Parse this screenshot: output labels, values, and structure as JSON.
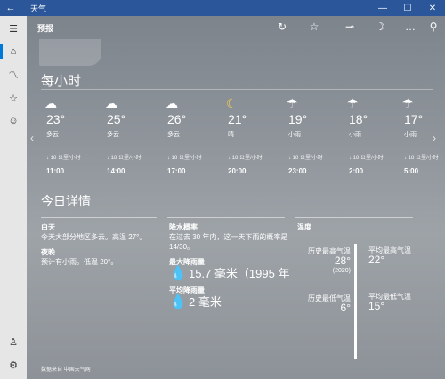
{
  "window": {
    "title": "天气",
    "back": "←",
    "minimize": "—",
    "maximize": "☐",
    "close": "✕"
  },
  "sidebar": {
    "menu": "☰",
    "items": [
      {
        "name": "home",
        "glyph": "⌂"
      },
      {
        "name": "chart",
        "glyph": "〽"
      },
      {
        "name": "favorites",
        "glyph": "☆"
      },
      {
        "name": "lifestyle",
        "glyph": "☺"
      }
    ],
    "bottom": [
      {
        "name": "account",
        "glyph": "♙"
      },
      {
        "name": "settings",
        "glyph": "⚙"
      }
    ]
  },
  "cmdbar": {
    "label": "预报",
    "refresh": "↻",
    "favorite": "☆",
    "pin": "⊸",
    "night": "☽",
    "more": "…",
    "search": "⚲"
  },
  "hourly": {
    "title": "每小时",
    "hours": [
      {
        "icon": "☁",
        "temp": "23°",
        "cond": "多云",
        "wind": "↓ 18 公里/小时",
        "time": "11:00"
      },
      {
        "icon": "☁",
        "temp": "25°",
        "cond": "多云",
        "wind": "↓ 18 公里/小时",
        "time": "14:00"
      },
      {
        "icon": "☁",
        "temp": "26°",
        "cond": "多云",
        "wind": "↓ 18 公里/小时",
        "time": "17:00"
      },
      {
        "icon": "☾",
        "temp": "21°",
        "cond": "晴",
        "wind": "↓ 18 公里/小时",
        "time": "20:00"
      },
      {
        "icon": "☂",
        "temp": "19°",
        "cond": "小雨",
        "wind": "↓ 18 公里/小时",
        "time": "23:00"
      },
      {
        "icon": "☂",
        "temp": "18°",
        "cond": "小雨",
        "wind": "↓ 18 公里/小时",
        "time": "2:00"
      },
      {
        "icon": "☂",
        "temp": "17°",
        "cond": "小雨",
        "wind": "↓ 18 公里/小时",
        "time": "5:00"
      }
    ],
    "prev": "‹",
    "next": "›"
  },
  "details": {
    "title": "今日详情",
    "day_label": "白天",
    "day_text": "今天大部分地区多云。高温 27°。",
    "night_label": "夜晚",
    "night_text": "预计有小雨。低温 20°。",
    "precip_label": "降水概率",
    "precip_text": "在过去 30 年内，这一天下雨的概率是 14/30。",
    "max_rain_label": "最大降雨量",
    "max_rain_value": "15.7 毫米（1995 年",
    "avg_rain_label": "平均降雨量",
    "avg_rain_value": "2 毫米",
    "temp_label": "温度",
    "record_high_label": "历史最高气温",
    "record_high_value": "28°",
    "record_high_year": "(2020)",
    "avg_high_label": "平均最高气温",
    "avg_high_value": "22°",
    "record_low_label": "历史最低气温",
    "record_low_value": "6°",
    "avg_low_label": "平均最低气温",
    "avg_low_value": "15°"
  },
  "footer": {
    "source": "数据来自 中国天气网"
  },
  "colors": {
    "titlebar": "#2b579a",
    "accent": "#0078d7",
    "sidebar": "#e6e6e6"
  }
}
